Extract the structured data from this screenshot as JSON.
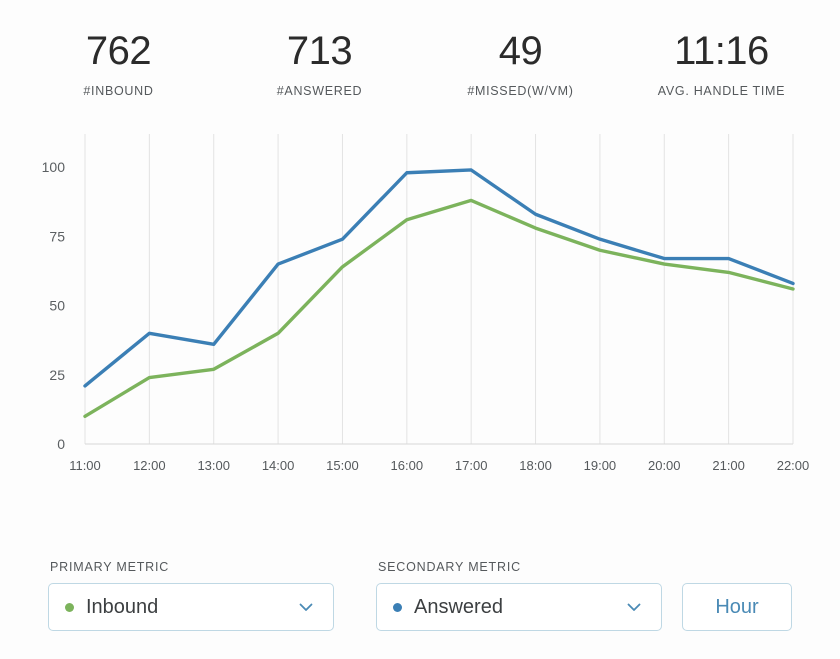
{
  "kpis": [
    {
      "value": "762",
      "label": "#INBOUND"
    },
    {
      "value": "713",
      "label": "#ANSWERED"
    },
    {
      "value": "49",
      "label": "#MISSED(W/VM)"
    },
    {
      "value": "11:16",
      "label": "AVG. HANDLE TIME"
    }
  ],
  "controls": {
    "primary_label": "PRIMARY METRIC",
    "primary_value": "Inbound",
    "primary_color": "#7cb35c",
    "secondary_label": "SECONDARY METRIC",
    "secondary_value": "Answered",
    "secondary_color": "#3b7fb5",
    "interval_button": "Hour",
    "chevron_icon": "chevron-down-icon"
  },
  "chart_data": {
    "type": "line",
    "title": "",
    "xlabel": "",
    "ylabel": "",
    "ylim": [
      0,
      112
    ],
    "yticks": [
      0,
      25,
      50,
      75,
      100
    ],
    "grid": true,
    "legend": "none",
    "x": [
      "11:00",
      "12:00",
      "13:00",
      "14:00",
      "15:00",
      "16:00",
      "17:00",
      "18:00",
      "19:00",
      "20:00",
      "21:00",
      "22:00"
    ],
    "series": [
      {
        "name": "Answered",
        "color": "#3b7fb5",
        "values": [
          21,
          40,
          36,
          65,
          74,
          98,
          99,
          83,
          74,
          67,
          67,
          58
        ]
      },
      {
        "name": "Inbound",
        "color": "#7cb35c",
        "values": [
          10,
          24,
          27,
          40,
          64,
          81,
          88,
          78,
          70,
          65,
          62,
          56
        ]
      }
    ]
  }
}
